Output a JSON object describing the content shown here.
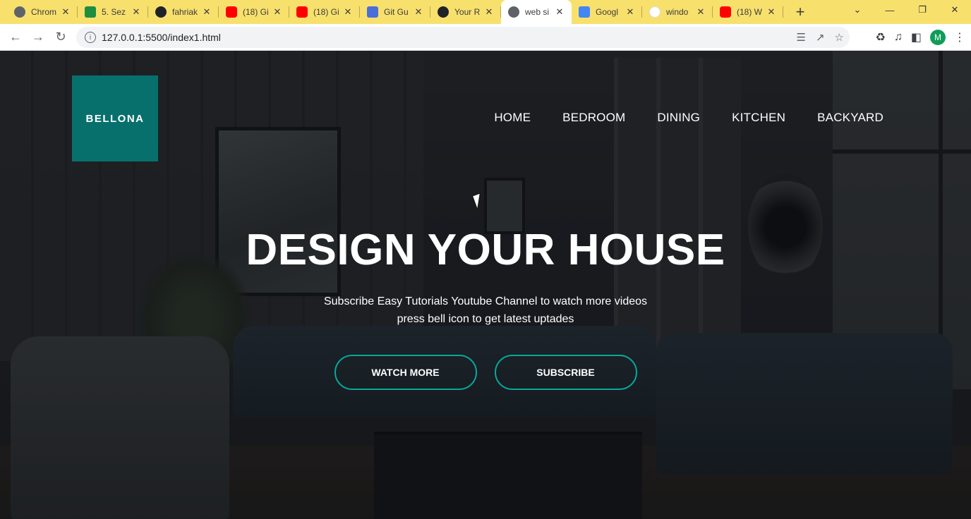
{
  "browser": {
    "tabs": [
      {
        "title": "Chrom",
        "icon": "chrome-icon",
        "favclass": "fav-chrome"
      },
      {
        "title": "5. Sez",
        "icon": "classroom-icon",
        "favclass": "fav-classroom"
      },
      {
        "title": "fahriak",
        "icon": "github-icon",
        "favclass": "fav-github"
      },
      {
        "title": "(18) Gi",
        "icon": "youtube-icon",
        "favclass": "fav-youtube"
      },
      {
        "title": "(18) Gi",
        "icon": "youtube-icon",
        "favclass": "fav-youtube"
      },
      {
        "title": "Git Gu",
        "icon": "git-icon",
        "favclass": "fav-git"
      },
      {
        "title": "Your R",
        "icon": "github-icon",
        "favclass": "fav-github"
      },
      {
        "title": "web si",
        "icon": "globe-icon",
        "favclass": "fav-web",
        "active": true
      },
      {
        "title": "Googl",
        "icon": "google-translate-icon",
        "favclass": "fav-translate"
      },
      {
        "title": "windo",
        "icon": "google-icon",
        "favclass": "fav-google"
      },
      {
        "title": "(18) W",
        "icon": "youtube-icon",
        "favclass": "fav-youtube"
      }
    ],
    "url": "127.0.0.1:5500/index1.html",
    "profile_initial": "M"
  },
  "site": {
    "logo_text": "BELLONA",
    "nav": [
      "HOME",
      "BEDROOM",
      "DINING",
      "KITCHEN",
      "BACKYARD"
    ],
    "hero_title": "DESIGN YOUR HOUSE",
    "hero_subtitle_line1": "Subscribe Easy Tutorials Youtube Channel to watch more videos",
    "hero_subtitle_line2": "press bell icon to get latest uptades",
    "buttons": {
      "watch_more": "WATCH MORE",
      "subscribe": "SUBSCRIBE"
    },
    "accent_color": "#0aa79b",
    "logo_color": "#07706d"
  }
}
